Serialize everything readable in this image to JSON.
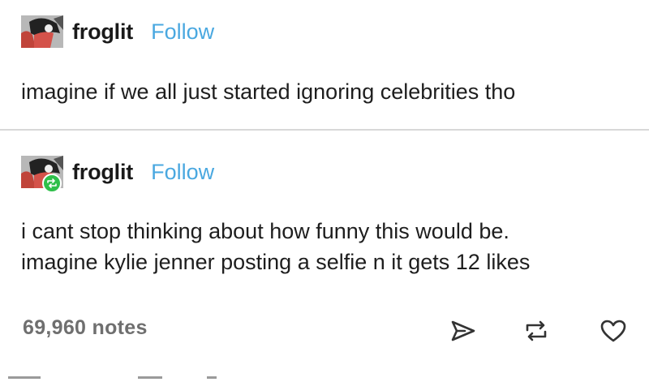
{
  "posts": [
    {
      "username": "froglit",
      "follow_label": "Follow",
      "text_lines": [
        "imagine if we all just started ignoring celebrities tho"
      ]
    },
    {
      "username": "froglit",
      "follow_label": "Follow",
      "text_lines": [
        "i cant stop thinking about how funny this would be.",
        "imagine kylie jenner posting a selfie n it gets 12 likes"
      ]
    }
  ],
  "footer": {
    "notes": "69,960 notes"
  },
  "icons": {
    "share": "share-icon",
    "reblog": "reblog-icon",
    "like": "heart-icon",
    "reblog_badge": "reblog-badge-icon"
  },
  "colors": {
    "follow": "#4aa8e0",
    "reblog_badge": "#2fbf4a",
    "text": "#1e1e1e",
    "notes": "#6f6f6f"
  }
}
